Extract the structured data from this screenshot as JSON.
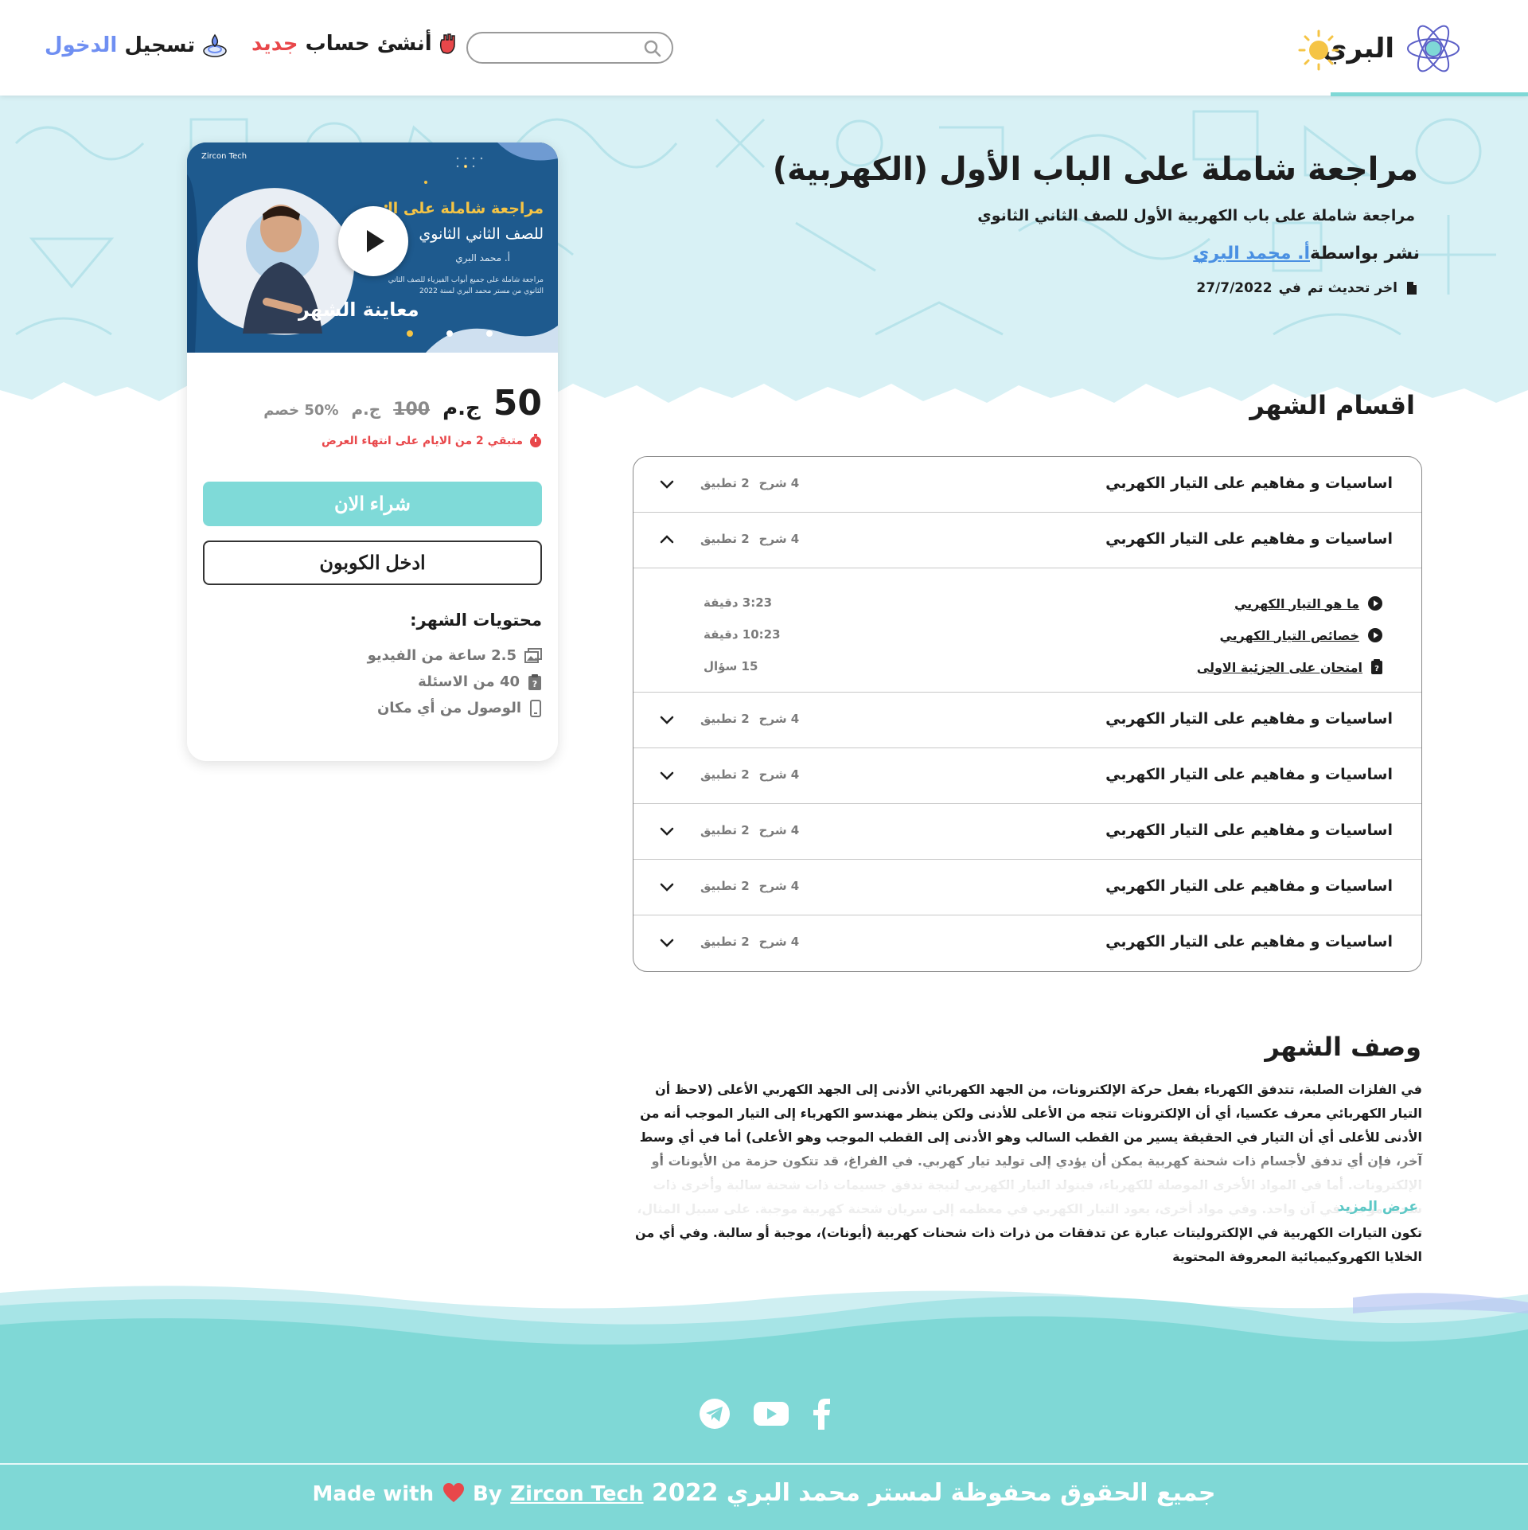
{
  "header": {
    "logo_text": "البري",
    "search_placeholder": "",
    "signup_prefix": "أنشئ حساب ",
    "signup_accent": "جديد",
    "login_prefix": "تسجيل ",
    "login_accent": "الدخول",
    "icons": [
      "atom-logo-icon",
      "sun-icon",
      "search-icon",
      "hand-icon",
      "fingerprint-icon"
    ]
  },
  "hero": {
    "title": "مراجعة شاملة على الباب الأول (الكهربية)",
    "subtitle": "مراجعة شاملة على باب الكهربية الأول للصف الثاني الثانوي",
    "published_by_label": "نشر بواسطة",
    "author": "أ. محمد البري",
    "updated_label": "اخر تحديث تم",
    "updated_in": "في",
    "updated_date": "27/7/2022"
  },
  "card": {
    "thumb_brand": "Zircon Tech",
    "thumb_title_line1": "مراجعة شاملة على المن",
    "thumb_title_line2": "للصف الثاني الثانوي",
    "thumb_teacher": "أ. محمد البري",
    "thumb_desc": "مراجعة شاملة على جميع أبواب الفيزياء للصف الثاني الثانوي من مستر محمد البري لسنة 2022",
    "preview_label": "معاينة الشهر",
    "price": "50",
    "currency": "ج.م",
    "old_price": "100",
    "old_currency": "ج.م",
    "discount": "50% خصم",
    "offer_note": "متبقي 2 من الايام على انتهاء العرض",
    "buy_label": "شراء الان",
    "coupon_label": "ادخل الكوبون",
    "contents_title": "محتويات الشهر:",
    "contents": [
      {
        "icon": "video-gallery-icon",
        "label": "2.5 ساعة من الفيديو"
      },
      {
        "icon": "clipboard-question-icon",
        "label": "40 من الاسئلة"
      },
      {
        "icon": "mobile-device-icon",
        "label": "الوصول من أي مكان"
      }
    ]
  },
  "sections": {
    "title": "اقسام الشهر",
    "rows": [
      {
        "title": "اساسيات و مفاهيم على التيار الكهربي",
        "explain": "4 شرح",
        "practice": "2 تطبيق",
        "open": false
      },
      {
        "title": "اساسيات و مفاهيم على التيار الكهربي",
        "explain": "4 شرح",
        "practice": "2 تطبيق",
        "open": true
      },
      {
        "title": "اساسيات و مفاهيم على التيار الكهربي",
        "explain": "4 شرح",
        "practice": "2 تطبيق",
        "open": false
      },
      {
        "title": "اساسيات و مفاهيم على التيار الكهربي",
        "explain": "4 شرح",
        "practice": "2 تطبيق",
        "open": false
      },
      {
        "title": "اساسيات و مفاهيم على التيار الكهربي",
        "explain": "4 شرح",
        "practice": "2 تطبيق",
        "open": false
      },
      {
        "title": "اساسيات و مفاهيم على التيار الكهربي",
        "explain": "4 شرح",
        "practice": "2 تطبيق",
        "open": false
      },
      {
        "title": "اساسيات و مفاهيم على التيار الكهربي",
        "explain": "4 شرح",
        "practice": "2 تطبيق",
        "open": false
      }
    ],
    "lessons": [
      {
        "icon": "play-circle-icon",
        "title": "ما هو التيار الكهربي",
        "duration": "3:23 دقيقة"
      },
      {
        "icon": "play-circle-icon",
        "title": "خصائص التيار الكهربي",
        "duration": "10:23 دقيقة"
      },
      {
        "icon": "clipboard-question-icon",
        "title": "امتحان على الجزئية الاولى",
        "duration": "15 سؤال"
      }
    ]
  },
  "description": {
    "title": "وصف الشهر",
    "text": "في الفلزات الصلبة، تتدفق الكهرباء بفعل حركة الإلكترونات، من الجهد الكهربائي الأدنى إلى الجهد الكهربي الأعلى (لاحظ أن التيار الكهربائي معرف عكسيا، أي أن الإلكترونات تتجه من الأعلى للأدنى ولكن ينظر مهندسو الكهرباء إلى التيار الموجب أنه من الأدنى للأعلى أي أن التيار في الحقيقة يسير من القطب السالب وهو الأدنى إلى القطب الموجب وهو الأعلى) أما في أي وسط آخر، فإن أي تدفق لأجسام ذات شحنة كهربية يمكن أن يؤدي إلى توليد تيار كهربي. في الفراغ، قد تتكون حزمة من الأيونات أو الإلكترونات. أما في المواد الأخرى الموصلة للكهرباء، فيتولد التيار الكهربي لتيجة تدفق جسيمات ذات شحنة سالبة وأخرى ذات شحنة موجبة في آن واحد. وفي مواد أخرى، يعود التيار الكهربي في معظمه إلى سريان شحنة كهربية موجبة. على سبيل المثال، تكون التيارات الكهربية في الإلكتروليتات عبارة عن تدفقات من ذرات ذات شحنات كهربية (أيونات)، موجبة أو سالبة. وفي أي من الخلايا الكهروكيميائية المعروفة المحتوية",
    "show_more": "عرض المزيد"
  },
  "footer": {
    "social": [
      "telegram-icon",
      "youtube-icon",
      "facebook-icon"
    ],
    "copyright": "جميع الحقوق محفوظة لمستر محمد البري 2022",
    "made_with": "Made with",
    "by": "By",
    "brand": "Zircon Tech"
  },
  "colors": {
    "accent_teal": "#7fd8d6",
    "accent_red": "#e8474a",
    "accent_blue": "#6f8ff2",
    "hero_bg": "#d8f1f5",
    "link_blue": "#4a90e2"
  }
}
